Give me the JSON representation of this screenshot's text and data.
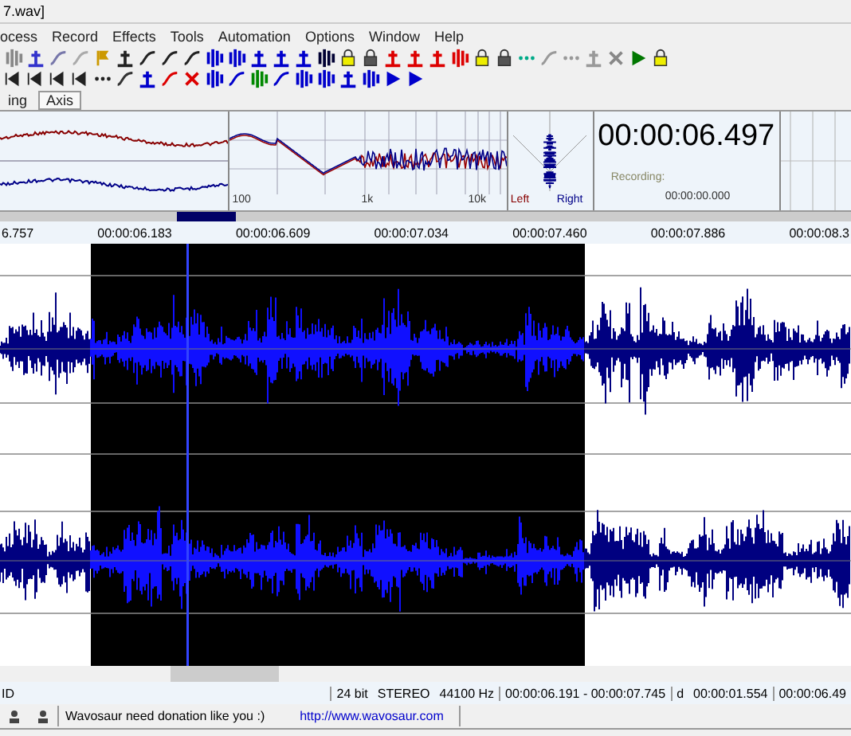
{
  "window": {
    "title": "7.wav]"
  },
  "menu": [
    "ocess",
    "Record",
    "Effects",
    "Tools",
    "Automation",
    "Options",
    "Window",
    "Help"
  ],
  "tabs": [
    {
      "label": "ing",
      "selected": false
    },
    {
      "label": "Axis",
      "selected": true
    }
  ],
  "spectrum": {
    "ticks": [
      "100",
      "1k",
      "10k"
    ]
  },
  "stereo": {
    "left": "Left",
    "right": "Right"
  },
  "time_display": {
    "time": "00:00:06.497",
    "recording_label": "Recording:",
    "recording_time": "00:00:00.000"
  },
  "ruler": [
    "6.757",
    "00:00:06.183",
    "00:00:06.609",
    "00:00:07.034",
    "00:00:07.460",
    "00:00:07.886",
    "00:00:08.3"
  ],
  "status_bar": {
    "field_1": "ID",
    "bits": "24 bit",
    "channels": "STEREO",
    "rate": "44100 Hz",
    "selection": "00:00:06.191 - 00:00:07.745",
    "length_label": "d",
    "length": "00:00:01.554",
    "position": "00:00:06.49"
  },
  "footer": {
    "message": "Wavosaur need donation like you :)",
    "link": "http://www.wavosaur.com"
  }
}
